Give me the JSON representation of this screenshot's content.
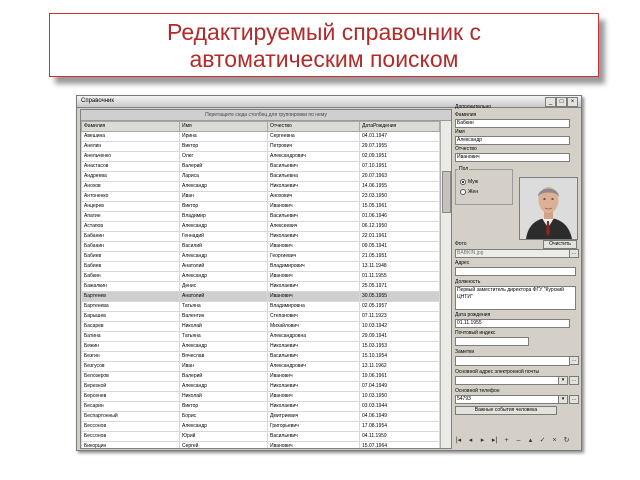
{
  "slide": {
    "title_line1": "Редактируемый справочник с",
    "title_line2": "автоматическим поиском"
  },
  "window": {
    "title": "Справочник",
    "buttons": {
      "minimize": "_",
      "maximize": "□",
      "close": "×"
    }
  },
  "grid": {
    "group_hint": "Перетащите сюда столбец для группировки по нему",
    "columns": [
      "Фамилия",
      "Имя",
      "Отчество",
      "ДатаРождения"
    ],
    "selected_row": 16,
    "rows": [
      [
        "Авешина",
        "Ирина",
        "Сергеевна",
        "04.01.1947"
      ],
      [
        "Анелин",
        "Виктор",
        "Петрович",
        "29.07.1955"
      ],
      [
        "Анельченко",
        "Олег",
        "Александрович",
        "02.09.1951"
      ],
      [
        "Анастасов",
        "Валерий",
        "Васильевич",
        "07.10.1951"
      ],
      [
        "Андреева",
        "Лариса",
        "Васильевна",
        "20.07.1963"
      ],
      [
        "Анохов",
        "Александр",
        "Николаевич",
        "14.06.1955"
      ],
      [
        "Антоненко",
        "Иван",
        "Анохович",
        "23.03.1950"
      ],
      [
        "Анцерев",
        "Виктор",
        "Иванович",
        "15.05.1961"
      ],
      [
        "Апатин",
        "Владимир",
        "Васильевич",
        "01.06.1946"
      ],
      [
        "Астапов",
        "Александр",
        "Алексеевич",
        "06.12.1950"
      ],
      [
        "Бабанин",
        "Геннадий",
        "Николаевич",
        "22.01.1961"
      ],
      [
        "Бабанин",
        "Василий",
        "Иванович",
        "09.05.1941"
      ],
      [
        "Бабиев",
        "Александр",
        "Георгиевич",
        "21.05.1951"
      ],
      [
        "Бабиев",
        "Анатолий",
        "Владимирович",
        "13.11.1948"
      ],
      [
        "Бабкин",
        "Александр",
        "Иванович",
        "01.11.1955"
      ],
      [
        "Бажалкин",
        "Денис",
        "Николаевич",
        "25.05.1971"
      ],
      [
        "Бартенев",
        "Анатолий",
        "Иванович",
        "30.05.1955"
      ],
      [
        "Бартенева",
        "Татьяна",
        "Владимировна",
        "02.05.1957"
      ],
      [
        "Барышев",
        "Валентин",
        "Степанович",
        "07.11.1923"
      ],
      [
        "Басарев",
        "Николай",
        "Михайлович",
        "10.03.1942"
      ],
      [
        "Батина",
        "Татьяна",
        "Александровна",
        "29.09.1941"
      ],
      [
        "Бежин",
        "Александр",
        "Николаевич",
        "15.03.1953"
      ],
      [
        "Безгин",
        "Вячеслав",
        "Васильевич",
        "15.10.1954"
      ],
      [
        "Безгусов",
        "Иван",
        "Александрович",
        "13.11.1962"
      ],
      [
        "Белозеров",
        "Валерий",
        "Иванович",
        "19.06.1961"
      ],
      [
        "Березной",
        "Александр",
        "Николаевич",
        "07.04.1949"
      ],
      [
        "Берсенев",
        "Николай",
        "Иванович",
        "10.03.1950"
      ],
      [
        "Бесарин",
        "Виктор",
        "Николаевич",
        "03.03.1944"
      ],
      [
        "Беспартонный",
        "Борис",
        "Дмитриевич",
        "04.06.1949"
      ],
      [
        "Бессонов",
        "Александр",
        "Григорьевич",
        "17.08.1954"
      ],
      [
        "Бессонов",
        "Юрий",
        "Васильевич",
        "04.11.1959"
      ],
      [
        "Бикорцин",
        "Сергей",
        "Иванович",
        "15.07.1964"
      ],
      [
        "Бобкова",
        "Валентина",
        "Васильевна",
        "20.10.1957"
      ],
      [
        "Бобрышев",
        "Сергей",
        "Иванович",
        "24.08.1957"
      ],
      [
        "Богданов",
        "Валентин",
        "Леонидович",
        "16.05.1954"
      ],
      [
        "Богданов",
        "Виктор",
        "Васильевич",
        "18.03.1955"
      ]
    ]
  },
  "detail": {
    "group_label": "Дополнительно",
    "surname_label": "Фамилия",
    "surname_value": "Бабкин",
    "name_label": "Имя",
    "name_value": "Александр",
    "patronymic_label": "Отчество",
    "patronymic_value": "Иванович",
    "sex_label": "Пол",
    "sex_options": [
      "Муж",
      "Жен"
    ],
    "sex_selected": "Муж",
    "photo_label": "Фото",
    "photo_value": "BABKIN.jpg",
    "clear_button": "Очистить",
    "address_label": "Адрес",
    "address_value": "",
    "position_label": "Должность",
    "position_value": "Первый заместитель директора ФГУ \"Курский ЦНТИ\"",
    "birthdate_label": "Дата рождения",
    "birthdate_value": "01.11.1955",
    "postcode_label": "Почтовый индекс",
    "postcode_value": "",
    "notes_label": "Заметки",
    "notes_value": "",
    "email_label": "Основной адрес электронной почты",
    "email_value": "",
    "phone_label": "Основной телефон",
    "phone_value": "54793",
    "events_button": "Важные события человека",
    "toolbar_icons": [
      "first-icon",
      "prev-icon",
      "next-icon",
      "last-icon",
      "add-icon",
      "delete-icon",
      "edit-icon",
      "save-icon",
      "cancel-icon",
      "refresh-icon"
    ],
    "toolbar_glyphs": [
      "|◂",
      "◂",
      "▸",
      "▸|",
      "+",
      "–",
      "▴",
      "✓",
      "×",
      "↻"
    ]
  }
}
